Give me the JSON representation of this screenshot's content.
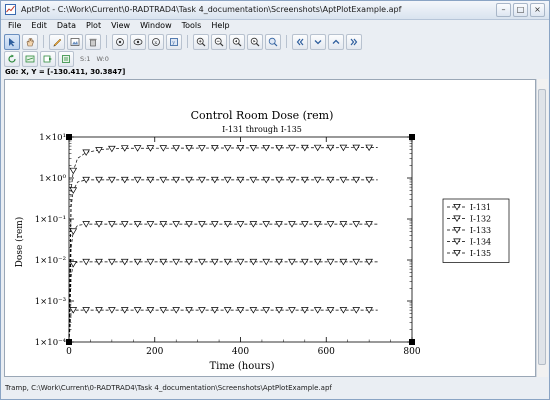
{
  "window": {
    "title": "AptPlot - C:\\Work\\Current\\0-RADTRAD4\\Task 4_documentation\\Screenshots\\AptPlotExample.apf"
  },
  "menu": [
    "File",
    "Edit",
    "Data",
    "Plot",
    "View",
    "Window",
    "Tools",
    "Help"
  ],
  "toolbar1": {
    "icons": [
      "pointer-icon",
      "hand-icon",
      "pencil-icon",
      "image-icon",
      "trash-icon",
      "eye-target-icon",
      "zoom-fit-icon",
      "zoom-x-icon",
      "zoom-y-icon",
      "zoom-in-icon",
      "zoom-out-icon",
      "zoom-left-icon",
      "zoom-right-icon",
      "zoom-reset-icon",
      "arrow-left-icon",
      "arrow-down-icon",
      "arrow-up-icon",
      "arrow-right-icon"
    ]
  },
  "toolbar2": {
    "icons": [
      "refresh-icon",
      "redraw-icon",
      "export-icon",
      "settings-icon"
    ],
    "s_label": "S:1",
    "w_label": "W:0"
  },
  "coords": "G0: X, Y = [-130.411, 30.3847]",
  "status": "Tramp, C:\\Work\\Current\\0-RADTRAD4\\Task 4_documentation\\Screenshots\\AptPlotExample.apf",
  "chart_data": {
    "type": "line",
    "title": "Control Room Dose (rem)",
    "subtitle": "I-131 through I-135",
    "xlabel": "Time (hours)",
    "ylabel": "Dose (rem)",
    "xlim": [
      0,
      800
    ],
    "ylim": [
      0.0001,
      10
    ],
    "yscale": "log",
    "xticks": [
      "0",
      "200",
      "400",
      "600",
      "800"
    ],
    "yticks": [
      "1×10⁻⁴",
      "1×10⁻³",
      "1×10⁻²",
      "1×10⁻¹",
      "1×10⁰",
      "1×10¹"
    ],
    "legend_position": "right",
    "marker": "down-triangle",
    "series": [
      {
        "name": "I-131",
        "plateau": 5.5,
        "x": [
          0,
          5,
          10,
          20,
          40,
          80,
          120,
          720
        ],
        "y": [
          0.0001,
          0.5,
          1.5,
          3.0,
          4.2,
          5.0,
          5.3,
          5.5
        ]
      },
      {
        "name": "I-132",
        "plateau": 0.9,
        "x": [
          0,
          5,
          10,
          20,
          40,
          720
        ],
        "y": [
          0.0001,
          0.2,
          0.5,
          0.8,
          0.9,
          0.9
        ]
      },
      {
        "name": "I-133",
        "plateau": 0.075,
        "x": [
          0,
          5,
          10,
          20,
          40,
          720
        ],
        "y": [
          0.0001,
          0.02,
          0.05,
          0.07,
          0.075,
          0.075
        ]
      },
      {
        "name": "I-134",
        "plateau": 0.009,
        "x": [
          0,
          5,
          10,
          20,
          720
        ],
        "y": [
          0.0001,
          0.004,
          0.008,
          0.009,
          0.009
        ]
      },
      {
        "name": "I-135",
        "plateau": 0.0006,
        "x": [
          0,
          5,
          10,
          720
        ],
        "y": [
          0.0001,
          0.0005,
          0.0006,
          0.0006
        ]
      }
    ]
  }
}
